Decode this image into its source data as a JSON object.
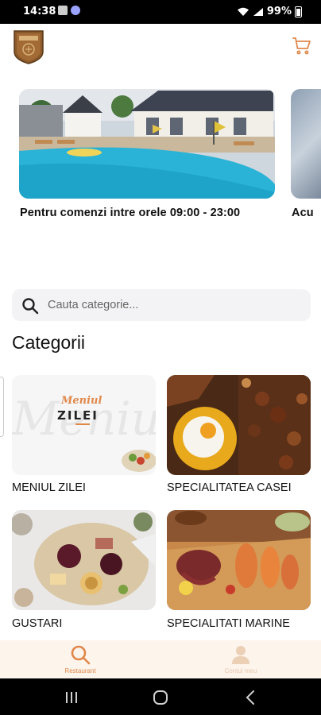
{
  "status_bar": {
    "time": "14:38",
    "battery": "99%"
  },
  "header": {
    "logo_icon": "restaurant-crest-logo",
    "cart_icon": "cart-icon"
  },
  "banners": [
    {
      "caption": "Pentru comenzi intre orele 09:00 - 23:00"
    },
    {
      "caption": "Acu"
    }
  ],
  "search": {
    "placeholder": "Cauta categorie...",
    "value": ""
  },
  "categories_title": "Categorii",
  "categories": [
    {
      "label": "MENIUL ZILEI",
      "overlay_title": "Meniul",
      "overlay_subtitle": "ZILEI",
      "watermark": "Meniu"
    },
    {
      "label": "SPECIALITATEA CASEI"
    },
    {
      "label": "GUSTARI"
    },
    {
      "label": "SPECIALITATI MARINE"
    }
  ],
  "bottom_nav": [
    {
      "label": "Restaurant",
      "icon": "search-icon",
      "active": true
    },
    {
      "label": "Contul meu",
      "icon": "user-icon",
      "active": false
    }
  ],
  "colors": {
    "accent": "#e0884a",
    "accent_light": "#e8c9ad",
    "nav_bg": "#fdf4ec",
    "search_bg": "#f3f3f5"
  }
}
